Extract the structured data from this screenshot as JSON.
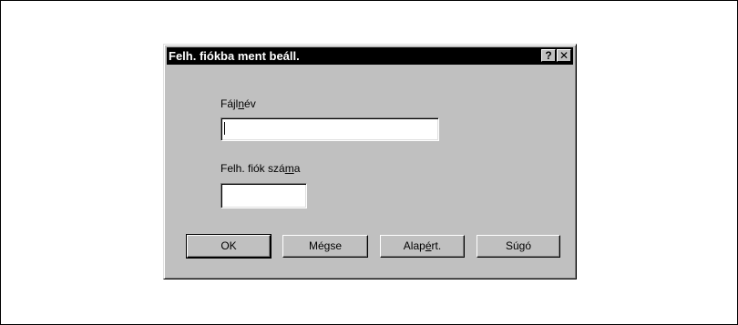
{
  "dialog": {
    "title": "Felh. fiókba ment beáll.",
    "help_button": "?",
    "close_button": "✕",
    "filename": {
      "label_before": "Fájl",
      "label_mnemonic": "n",
      "label_after": "év",
      "value": ""
    },
    "box_number": {
      "label_before": "Felh. fiók szá",
      "label_mnemonic": "m",
      "label_after": "a",
      "value": ""
    },
    "buttons": {
      "ok": "OK",
      "cancel": "Mégse",
      "default_before": "Alap",
      "default_mnemonic": "é",
      "default_after": "rt.",
      "help": "Súgó"
    }
  }
}
